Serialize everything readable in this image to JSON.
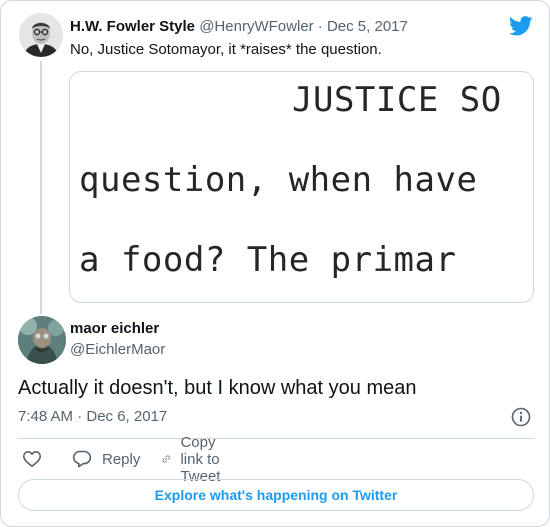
{
  "parent_tweet": {
    "author_name": "H.W. Fowler Style",
    "author_handle": "@HenryWFowler",
    "separator": "·",
    "date": "Dec 5, 2017",
    "text": "No, Justice Sotomayor, it *raises* the question.",
    "image_text": {
      "line1": "JUSTICE SO",
      "line2": "question, when have",
      "line3": "a food?  The primar"
    }
  },
  "reply": {
    "author_name": "maor eichler",
    "author_handle": "@EichlerMaor",
    "text": "Actually it doesn't, but I know what you mean",
    "time": "7:48 AM · Dec 6, 2017"
  },
  "actions": {
    "reply_label": "Reply",
    "copy_label": "Copy link to Tweet"
  },
  "explore_label": "Explore what's happening on Twitter",
  "colors": {
    "accent": "#1d9bf0",
    "secondary_text": "#536471",
    "border": "#cfd9de"
  },
  "icons": [
    "twitter-bird-icon",
    "info-icon",
    "heart-icon",
    "reply-icon",
    "link-icon"
  ]
}
